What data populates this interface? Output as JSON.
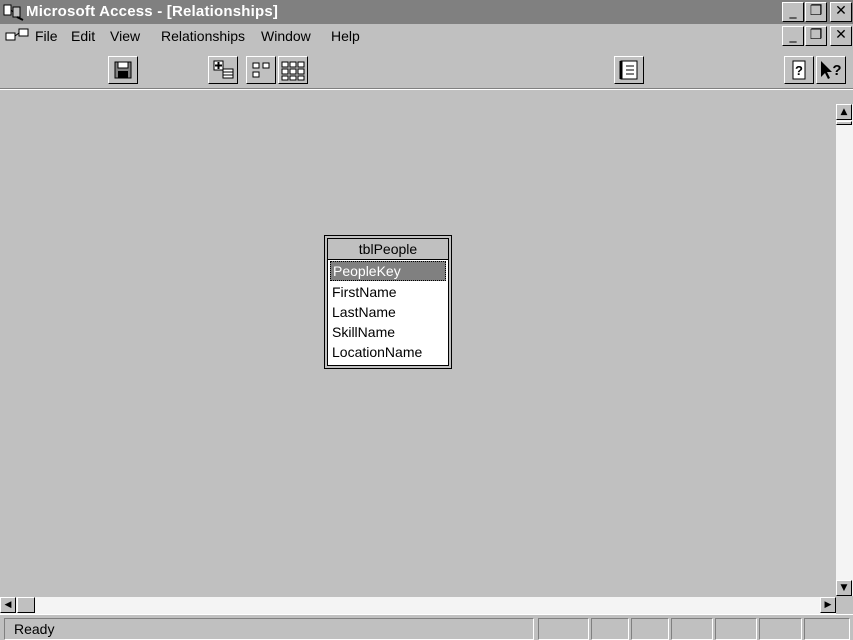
{
  "window": {
    "title": "Microsoft Access - [Relationships]"
  },
  "menu": {
    "items": [
      "File",
      "Edit",
      "View",
      "Relationships",
      "Window",
      "Help"
    ]
  },
  "toolbar": {
    "buttons": [
      "save-icon",
      "show-table-icon",
      "show-direct-icon",
      "show-all-icon",
      "database-window-icon",
      "help-icon",
      "whats-this-icon"
    ]
  },
  "table": {
    "name": "tblPeople",
    "fields": [
      "PeopleKey",
      "FirstName",
      "LastName",
      "SkillName",
      "LocationName"
    ]
  },
  "status": {
    "text": "Ready"
  },
  "colors": {
    "face": "#c0c0c0",
    "titlebar": "#808080",
    "highlight": "#808080"
  }
}
